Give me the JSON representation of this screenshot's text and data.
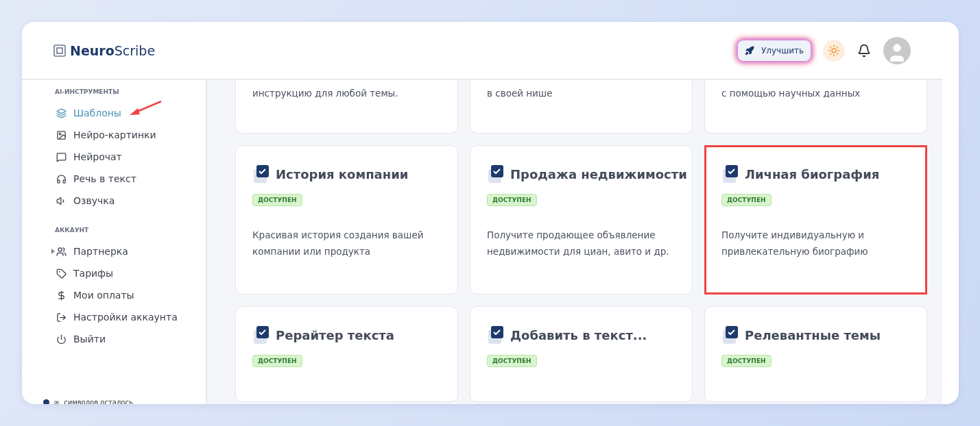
{
  "logo": {
    "bold": "Neuro",
    "light": "Scribe"
  },
  "header": {
    "upgrade_button": "Улучшить"
  },
  "sidebar": {
    "sections": [
      {
        "title": "AI-ИНСТРУМЕНТЫ",
        "items": [
          {
            "label": "Шаблоны",
            "selected": true,
            "expandable": false
          },
          {
            "label": "Нейро-картинки",
            "selected": false,
            "expandable": false
          },
          {
            "label": "Нейрочат",
            "selected": false,
            "expandable": false
          },
          {
            "label": "Речь в текст",
            "selected": false,
            "expandable": false
          },
          {
            "label": "Озвучка",
            "selected": false,
            "expandable": false
          }
        ]
      },
      {
        "title": "АККАУНТ",
        "items": [
          {
            "label": "Партнерка",
            "selected": false,
            "expandable": true
          },
          {
            "label": "Тарифы",
            "selected": false,
            "expandable": false
          },
          {
            "label": "Мои оплаты",
            "selected": false,
            "expandable": false
          },
          {
            "label": "Настройки аккаунта",
            "selected": false,
            "expandable": false
          },
          {
            "label": "Выйти",
            "selected": false,
            "expandable": false
          }
        ]
      }
    ],
    "footer_symbol": "∞",
    "footer": "символов осталось"
  },
  "cards_top": [
    "инструкцию для любой темы.",
    "в своей нише",
    "с помощью научных данных"
  ],
  "cards": [
    {
      "title": "История компании",
      "badge": "ДОСТУПЕН",
      "description": "Красивая история создания вашей компании или продукта",
      "highlighted": false
    },
    {
      "title": "Продажа недвижимости",
      "badge": "ДОСТУПЕН",
      "description": "Получите продающее объявление недвижимости для циан, авито и др.",
      "highlighted": false
    },
    {
      "title": "Личная биография",
      "badge": "ДОСТУПЕН",
      "description": "Получите индивидуальную и привлекательную биографию",
      "highlighted": true
    },
    {
      "title": "Рерайтер текста",
      "badge": "ДОСТУПЕН",
      "highlighted": false
    },
    {
      "title": "Добавить в текст...",
      "badge": "ДОСТУПЕН",
      "highlighted": false
    },
    {
      "title": "Релевантные темы",
      "badge": "ДОСТУПЕН",
      "highlighted": false
    }
  ]
}
